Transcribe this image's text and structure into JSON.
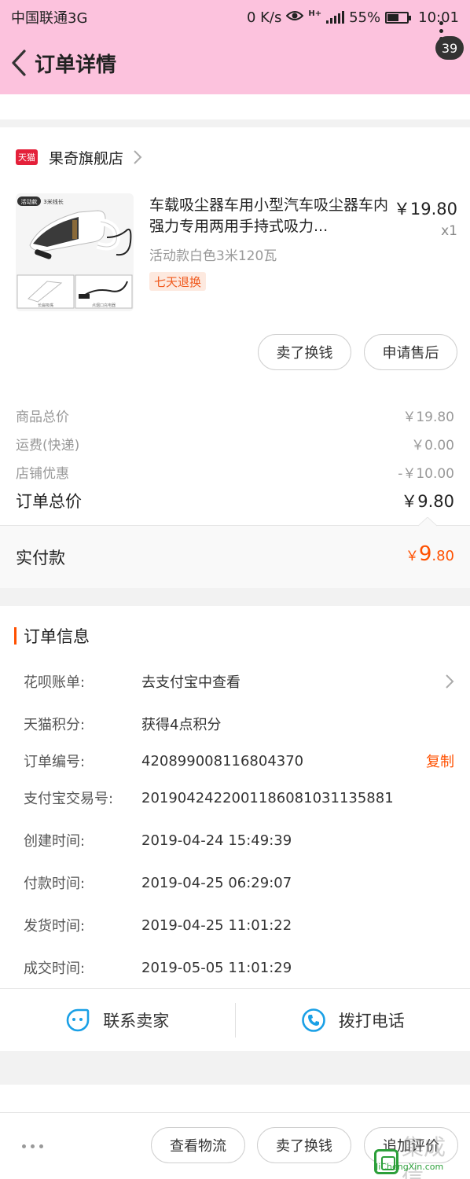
{
  "status_bar": {
    "carrier": "中国联通3G",
    "speed": "0 K/s",
    "network": "H+",
    "battery_percent": "55%",
    "battery_level": 0.55,
    "time": "10:01"
  },
  "header": {
    "title": "订单详情",
    "badge_count": "39"
  },
  "shop": {
    "platform_tag": "天猫",
    "name": "果奇旗舰店"
  },
  "product": {
    "name": "车载吸尘器车用小型汽车吸尘器车内强力专用两用手持式吸力...",
    "price": "￥19.80",
    "quantity": "x1",
    "sku": "活动款白色3米120瓦",
    "service_tag": "七天退换",
    "image_labels": {
      "promo": "活动款",
      "cable": "3米线长",
      "accessory1": "长扁吸嘴",
      "accessory2": "点烟口充电器"
    },
    "actions": {
      "sell": "卖了换钱",
      "after_sale": "申请售后"
    }
  },
  "summary": {
    "goods_total_label": "商品总价",
    "goods_total_value": "￥19.80",
    "shipping_label": "运费(快递)",
    "shipping_value": "￥0.00",
    "discount_label": "店铺优惠",
    "discount_value": "-￥10.00",
    "order_total_label": "订单总价",
    "order_total_value": "￥9.80",
    "paid_label": "实付款",
    "paid_currency": "￥",
    "paid_int": "9",
    "paid_dec": ".80"
  },
  "order_info": {
    "title": "订单信息",
    "rows": [
      {
        "label": "花呗账单:",
        "value": "去支付宝中查看"
      },
      {
        "label": "天猫积分:",
        "value": "获得4点积分"
      },
      {
        "label": "订单编号:",
        "value": "420899008116804370",
        "action": "复制"
      },
      {
        "label": "支付宝交易号:",
        "value": "2019042422001186081031135881"
      },
      {
        "label": "创建时间:",
        "value": "2019-04-24 15:49:39"
      },
      {
        "label": "付款时间:",
        "value": "2019-04-25 06:29:07"
      },
      {
        "label": "发货时间:",
        "value": "2019-04-25 11:01:22"
      },
      {
        "label": "成交时间:",
        "value": "2019-05-05 11:01:29"
      }
    ]
  },
  "contact": {
    "seller": "联系卖家",
    "phone": "拨打电话"
  },
  "bottom_actions": {
    "logistics": "查看物流",
    "sell": "卖了换钱",
    "review": "追加评价"
  },
  "watermark": {
    "text": "集成信",
    "url": "JiChengXin.com"
  },
  "colors": {
    "header_bg": "#fcc2dd",
    "accent": "#ff5000",
    "tmall_red": "#e4203a",
    "icon_blue": "#1aa0e6"
  }
}
